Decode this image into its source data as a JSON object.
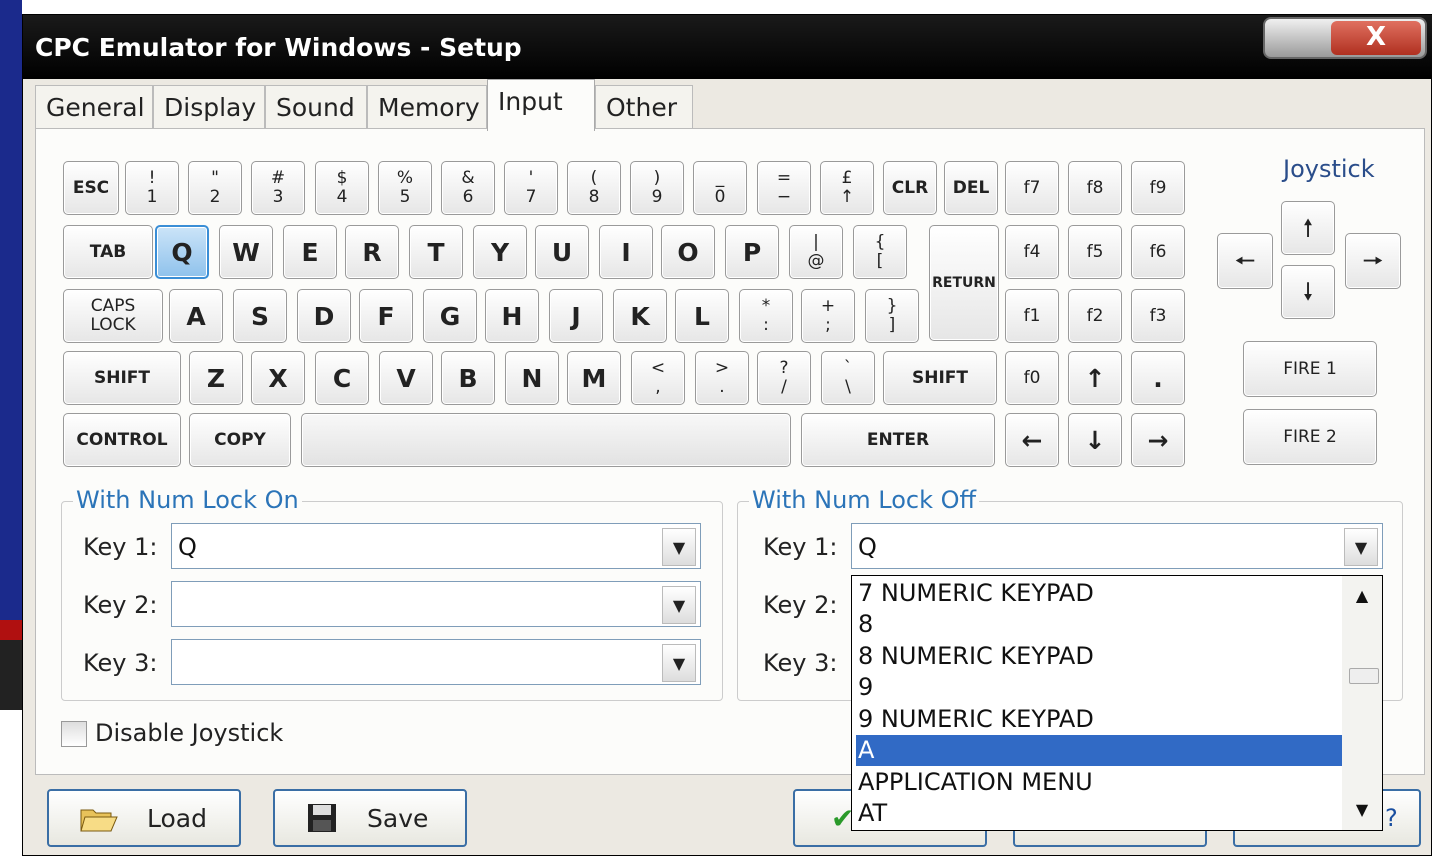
{
  "window": {
    "title": "CPC Emulator for Windows - Setup",
    "close_label": "X"
  },
  "tabs": [
    {
      "label": "General"
    },
    {
      "label": "Display"
    },
    {
      "label": "Sound"
    },
    {
      "label": "Memory"
    },
    {
      "label": "Input",
      "active": true
    },
    {
      "label": "Other"
    }
  ],
  "keyboard": {
    "row1": [
      {
        "top": "ESC"
      },
      {
        "top": "!",
        "bottom": "1"
      },
      {
        "top": "\"",
        "bottom": "2"
      },
      {
        "top": "#",
        "bottom": "3"
      },
      {
        "top": "$",
        "bottom": "4"
      },
      {
        "top": "%",
        "bottom": "5"
      },
      {
        "top": "&",
        "bottom": "6"
      },
      {
        "top": "'",
        "bottom": "7"
      },
      {
        "top": "(",
        "bottom": "8"
      },
      {
        "top": ")",
        "bottom": "9"
      },
      {
        "top": "_",
        "bottom": "0"
      },
      {
        "top": "=",
        "bottom": "−"
      },
      {
        "top": "£",
        "bottom": "↑"
      },
      {
        "top": "CLR"
      },
      {
        "top": "DEL"
      },
      {
        "top": "f7"
      },
      {
        "top": "f8"
      },
      {
        "top": "f9"
      }
    ],
    "row2": [
      {
        "top": "TAB"
      },
      {
        "top": "Q"
      },
      {
        "top": "W"
      },
      {
        "top": "E"
      },
      {
        "top": "R"
      },
      {
        "top": "T"
      },
      {
        "top": "Y"
      },
      {
        "top": "U"
      },
      {
        "top": "I"
      },
      {
        "top": "O"
      },
      {
        "top": "P"
      },
      {
        "top": "|",
        "bottom": "@"
      },
      {
        "top": "{",
        "bottom": "["
      },
      {
        "top": "RETURN"
      },
      {
        "top": "f4"
      },
      {
        "top": "f5"
      },
      {
        "top": "f6"
      }
    ],
    "row3": [
      {
        "top": "CAPS",
        "bottom": "LOCK"
      },
      {
        "top": "A"
      },
      {
        "top": "S"
      },
      {
        "top": "D"
      },
      {
        "top": "F"
      },
      {
        "top": "G"
      },
      {
        "top": "H"
      },
      {
        "top": "J"
      },
      {
        "top": "K"
      },
      {
        "top": "L"
      },
      {
        "top": "*",
        "bottom": ":"
      },
      {
        "top": "+",
        "bottom": ";"
      },
      {
        "top": "}",
        "bottom": "]"
      },
      {
        "top": "f1"
      },
      {
        "top": "f2"
      },
      {
        "top": "f3"
      }
    ],
    "row4": [
      {
        "top": "SHIFT"
      },
      {
        "top": "Z"
      },
      {
        "top": "X"
      },
      {
        "top": "C"
      },
      {
        "top": "V"
      },
      {
        "top": "B"
      },
      {
        "top": "N"
      },
      {
        "top": "M"
      },
      {
        "top": "<",
        "bottom": ","
      },
      {
        "top": ">",
        "bottom": "."
      },
      {
        "top": "?",
        "bottom": "/"
      },
      {
        "top": "`",
        "bottom": "\\"
      },
      {
        "top": "SHIFT"
      },
      {
        "top": "f0"
      },
      {
        "top": "↑"
      },
      {
        "top": "."
      }
    ],
    "row5": [
      {
        "top": "CONTROL"
      },
      {
        "top": "COPY"
      },
      {
        "top": ""
      },
      {
        "top": "ENTER"
      },
      {
        "top": "←"
      },
      {
        "top": "↓"
      },
      {
        "top": "→"
      }
    ]
  },
  "joystick": {
    "title": "Joystick",
    "up": "🠕",
    "down": "🠗",
    "left": "🠔",
    "right": "🠖",
    "fire1": "FIRE 1",
    "fire2": "FIRE 2"
  },
  "num_lock_on": {
    "label": "With Num Lock On",
    "key1_label": "Key 1:",
    "key1_value": "Q",
    "key2_label": "Key 2:",
    "key2_value": "",
    "key3_label": "Key 3:",
    "key3_value": ""
  },
  "num_lock_off": {
    "label": "With Num Lock Off",
    "key1_label": "Key 1:",
    "key1_value": "Q",
    "key2_label": "Key 2:",
    "key3_label": "Key 3:"
  },
  "disable_joystick": {
    "label": "Disable Joystick",
    "checked": false
  },
  "buttons": {
    "load": "Load",
    "save": "Save"
  },
  "dropdown": {
    "items": [
      {
        "label": "7 NUMERIC KEYPAD"
      },
      {
        "label": "8"
      },
      {
        "label": "8 NUMERIC KEYPAD"
      },
      {
        "label": "9"
      },
      {
        "label": "9 NUMERIC KEYPAD"
      },
      {
        "label": "A",
        "selected": true
      },
      {
        "label": "APPLICATION MENU"
      },
      {
        "label": "AT"
      }
    ]
  },
  "colors": {
    "title_bar": "#000000",
    "selection": "#316ac5",
    "group_label": "#2b74b8",
    "accent_key": "#8fc2ec"
  }
}
